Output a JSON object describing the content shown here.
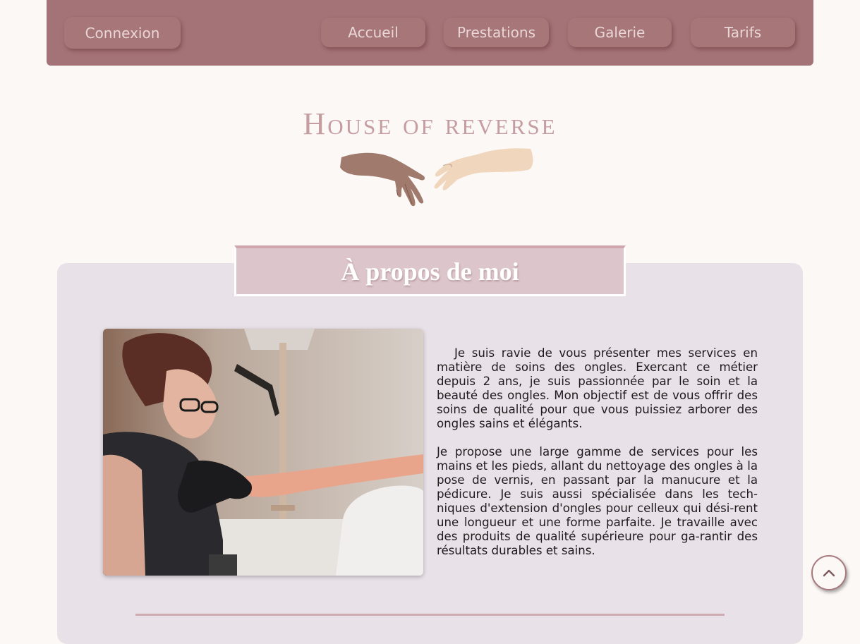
{
  "nav": {
    "login_label": "Connexion",
    "items": [
      {
        "label": "Accueil"
      },
      {
        "label": "Prestations"
      },
      {
        "label": "Galerie"
      },
      {
        "label": "Tarifs"
      }
    ]
  },
  "brand": {
    "title": "House of reverse",
    "logo_icon": "reaching-hands-icon"
  },
  "about": {
    "title": "À propos de moi",
    "paragraphs": [
      "Je suis ravie de vous présenter mes services en matière de soins des ongles. Exercant ce métier depuis 2 ans, je suis passionnée par le soin et la beauté des ongles. Mon objectif est de vous offrir des soins de qualité pour que vous puissiez arborer des ongles sains et élégants.",
      "Je propose une large gamme de services pour les mains et les pieds, allant du nettoyage des ongles à la pose de vernis, en passant par la manucure et la pédicure. Je suis aussi spécialisée dans les tech-niques d'extension d'ongles pour celleux qui dési-rent une longueur et une forme parfaite. Je travaille avec des produits de qualité supérieure pour ga-rantir des résultats durables et sains."
    ]
  },
  "scroll_top_icon": "chevron-up-icon",
  "colors": {
    "nav_bg": "#a47377",
    "nav_text": "#ead6d6",
    "brand": "#c59da1",
    "card_bg": "#e8e1e7",
    "title_box": "#dcc6cb",
    "page_bg": "#fcf8f6"
  }
}
